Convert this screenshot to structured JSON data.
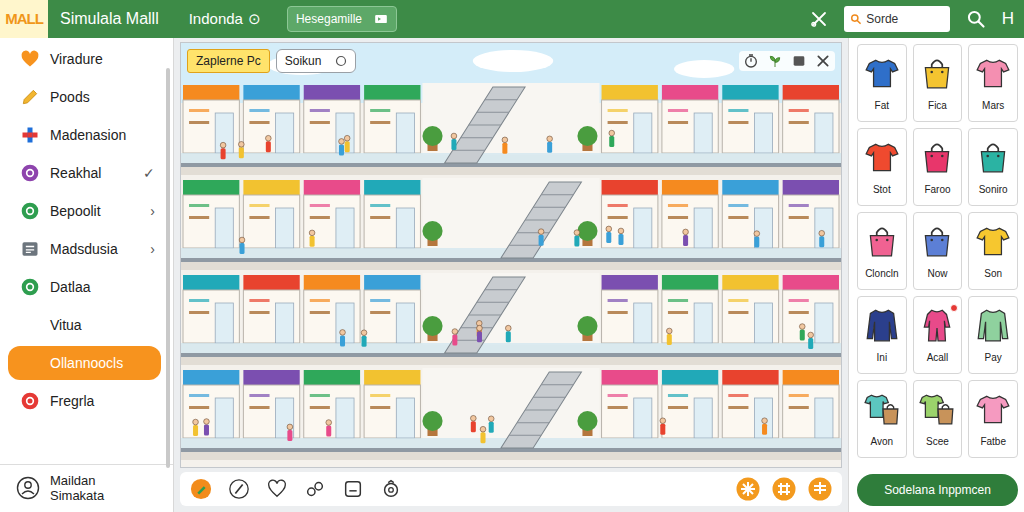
{
  "app": {
    "logo": "MALL",
    "title": "Simulala Malll",
    "location": "Indonda",
    "location_icon": "⊙",
    "chip": "Hesegamille",
    "avatar": "H"
  },
  "search": {
    "placeholder": "Sorde"
  },
  "sidebar": {
    "items": [
      {
        "label": "Viradure",
        "selected": false,
        "color": "#f7931e"
      },
      {
        "label": "Poods",
        "selected": false,
        "color": "#f2b630"
      },
      {
        "label": "Madenasion",
        "selected": false,
        "color": "#e53935"
      },
      {
        "label": "Reakhal",
        "selected": false,
        "trailing": "✓",
        "color": "#8e44ad"
      },
      {
        "label": "Bepoolit",
        "selected": false,
        "trailing": "›",
        "color": "#2e9e4f"
      },
      {
        "label": "Madsdusia",
        "selected": false,
        "trailing": "›",
        "color": "#6c757d"
      },
      {
        "label": "Datlaa",
        "selected": false,
        "color": "#2e9e4f"
      },
      {
        "label": "Vitua",
        "selected": false
      },
      {
        "label": "Ollannoocls",
        "selected": true
      },
      {
        "label": "Fregrla",
        "selected": false,
        "color": "#e53935"
      }
    ],
    "footer": {
      "label": "Maildan Simakata"
    }
  },
  "canvas": {
    "tag": "Zaplerne Pc",
    "chip": "Soikun"
  },
  "catalog": {
    "items": [
      {
        "label": "Fat",
        "kind": "shirt",
        "color": "#2f6fc9",
        "badge": false
      },
      {
        "label": "Fica",
        "kind": "bag",
        "color": "#f4c430",
        "badge": false
      },
      {
        "label": "Mars",
        "kind": "shirt",
        "color": "#f48fb1",
        "badge": false
      },
      {
        "label": "Stot",
        "kind": "shirt",
        "color": "#ef4a2f",
        "badge": false
      },
      {
        "label": "Faroo",
        "kind": "bag",
        "color": "#e8366b",
        "badge": false
      },
      {
        "label": "Soniro",
        "kind": "bag",
        "color": "#2bb3a3",
        "badge": false
      },
      {
        "label": "Cloncln",
        "kind": "bag",
        "color": "#f06292",
        "badge": false
      },
      {
        "label": "Now",
        "kind": "bag",
        "color": "#5c7fd6",
        "badge": false
      },
      {
        "label": "Son",
        "kind": "shirt",
        "color": "#f6c72f",
        "badge": false
      },
      {
        "label": "Ini",
        "kind": "longsleeve",
        "color": "#2b3f8c",
        "badge": false
      },
      {
        "label": "Acall",
        "kind": "outfit",
        "color": "#e84a8a",
        "badge": true
      },
      {
        "label": "Pay",
        "kind": "longsleeve",
        "color": "#8fd19e",
        "badge": false
      },
      {
        "label": "Avon",
        "kind": "combo",
        "color": "#5cc6c0",
        "badge": false
      },
      {
        "label": "Scee",
        "kind": "combo",
        "color": "#9bd36b",
        "badge": false
      },
      {
        "label": "Fatbe",
        "kind": "shirt",
        "color": "#f59ac0",
        "badge": false
      }
    ]
  },
  "action": {
    "label": "Sodelana Inppmcen"
  }
}
